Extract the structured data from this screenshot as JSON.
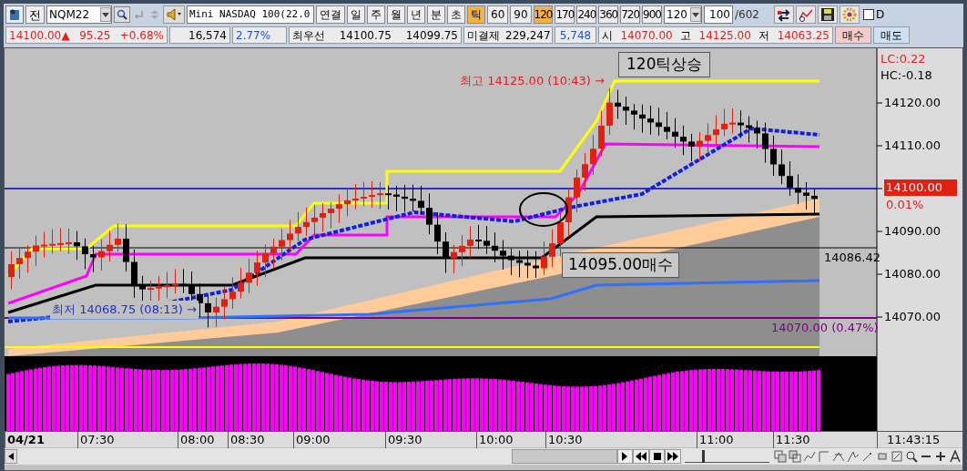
{
  "toolbar": {
    "market_button": "전",
    "symbol": "NQM22",
    "name": "Mini NASDAQ 100(22.0",
    "periods": [
      {
        "label": "연결",
        "selected": false
      },
      {
        "label": "일",
        "selected": false
      },
      {
        "label": "주",
        "selected": false
      },
      {
        "label": "월",
        "selected": false
      },
      {
        "label": "년",
        "selected": false
      },
      {
        "label": "분",
        "selected": false
      },
      {
        "label": "초",
        "selected": false
      },
      {
        "label": "틱",
        "selected": true
      },
      {
        "label": "60",
        "selected": false
      },
      {
        "label": "90",
        "selected": false
      },
      {
        "label": "120",
        "selected": true
      },
      {
        "label": "170",
        "selected": false
      },
      {
        "label": "240",
        "selected": false
      },
      {
        "label": "360",
        "selected": false
      },
      {
        "label": "720",
        "selected": false
      },
      {
        "label": "900",
        "selected": false
      }
    ],
    "interval": "120",
    "count": "100",
    "total": "/602",
    "d_checkbox": {
      "label": "D",
      "checked": false
    }
  },
  "quote": {
    "price": "14100.00",
    "arrow": "▲",
    "change": "95.25",
    "change_pct": "+0.68%",
    "volume": "16,574",
    "volume_pct": "2.77%",
    "best_label": "최우선",
    "ask": "14100.75",
    "bid": "14099.75",
    "open_interest_label": "미결제",
    "open_interest": "229,247",
    "oi_change": "5,748",
    "open_label": "시",
    "open": "14070.00",
    "high_label": "고",
    "high": "14125.00",
    "low_label": "저",
    "low": "14063.25",
    "buy_button": "매수",
    "sell_button": "매도"
  },
  "chart": {
    "lc": "LC:0.22",
    "hc": "HC:-0.18",
    "y_labels": [
      "14120.00",
      "14110.00",
      "14090.00",
      "14080.00",
      "14070.00"
    ],
    "current_price": "14100.00",
    "current_pct": "0.01%",
    "signal_label": "120틱상승",
    "high_note": "최고 14125.00 (10:43) →",
    "buy_label": "14095.00매수",
    "low_note": "최저 14068.75 (08:13) →",
    "level_label": "14086.42",
    "open_line_label": "14070.00 (0.47%)",
    "x_labels": [
      "04/21",
      "07:30",
      "08:00",
      "08:30",
      "09:00",
      "09:30",
      "10:00",
      "10:30",
      "11:00",
      "11:30"
    ],
    "timestamp": "11:43:15",
    "zoom_slider": {
      "level": 0.2
    }
  }
}
